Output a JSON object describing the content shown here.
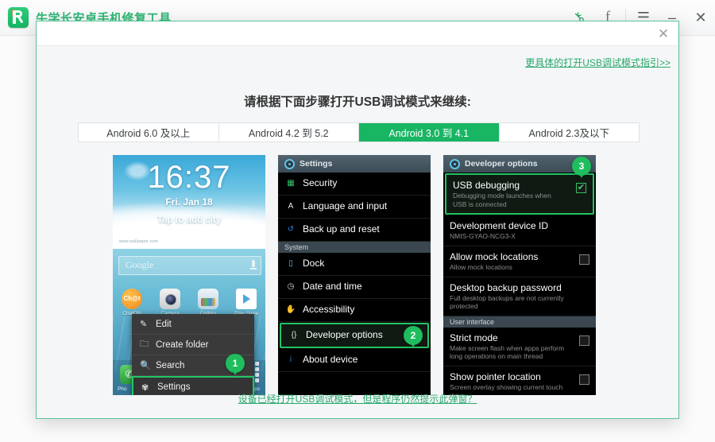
{
  "titlebar": {
    "app_title": "牛学长安卓手机修复工具",
    "icons": {
      "key": "key-icon",
      "facebook": "f",
      "menu": "☰",
      "minimize": "–",
      "close": "✕"
    }
  },
  "dialog": {
    "close_label": "✕",
    "guide_link": "更具体的打开USB调试模式指引>>",
    "headline": "请根据下面步骤打开USB调试模式来继续:",
    "bottom_link": "设备已经打开USB调试模式，但是程序仍然提示此弹窗？",
    "tabs": [
      {
        "label": "Android 6.0 及以上",
        "active": false
      },
      {
        "label": "Android 4.2 到 5.2",
        "active": false
      },
      {
        "label": "Android 3.0 到 4.1",
        "active": true
      },
      {
        "label": "Android 2.3及以下",
        "active": false
      }
    ]
  },
  "phone1": {
    "clock": "16:37",
    "date": "Fri. Jan 18",
    "city": "Tap to add city",
    "tiny": "www.wallpaper.com",
    "google": "Google",
    "apps": [
      {
        "label": "ChatON"
      },
      {
        "label": "Camera"
      },
      {
        "label": "Gallery"
      },
      {
        "label": "Play Store"
      }
    ],
    "chat_text": "Ch@t",
    "dock_phone": "Pho",
    "dock_apps": "pps",
    "menu": [
      {
        "icon": "✎",
        "label": "Edit",
        "selected": false
      },
      {
        "icon": "🗀",
        "label": "Create folder",
        "selected": false
      },
      {
        "icon": "🔍",
        "label": "Search",
        "selected": false
      },
      {
        "icon": "✾",
        "label": "Settings",
        "selected": true
      }
    ],
    "badge": "1"
  },
  "phone2": {
    "header": "Settings",
    "badge": "2",
    "rows": [
      {
        "kind": "item",
        "icon": "▦",
        "icon_color": "#2ec46a",
        "title": "Security",
        "sub": "",
        "selected": false
      },
      {
        "kind": "item",
        "icon": "A",
        "icon_color": "#e8e8e8",
        "title": "Language and input",
        "sub": "",
        "selected": false
      },
      {
        "kind": "item",
        "icon": "↺",
        "icon_color": "#2a86d6",
        "title": "Back up and reset",
        "sub": "",
        "selected": false
      },
      {
        "kind": "section",
        "title": "System"
      },
      {
        "kind": "item",
        "icon": "▯",
        "icon_color": "#6ab6e8",
        "title": "Dock",
        "sub": "",
        "selected": false
      },
      {
        "kind": "item",
        "icon": "◷",
        "icon_color": "#dcdcdc",
        "title": "Date and time",
        "sub": "",
        "selected": false
      },
      {
        "kind": "item",
        "icon": "✋",
        "icon_color": "#f0c14b",
        "title": "Accessibility",
        "sub": "",
        "selected": false
      },
      {
        "kind": "item",
        "icon": "{}",
        "icon_color": "#dcdcdc",
        "title": "Developer options",
        "sub": "",
        "selected": true
      },
      {
        "kind": "item",
        "icon": "i",
        "icon_color": "#2a86d6",
        "title": "About device",
        "sub": "",
        "selected": false
      }
    ]
  },
  "phone3": {
    "header": "Developer options",
    "badge": "3",
    "rows": [
      {
        "kind": "item",
        "title": "USB debugging",
        "sub": "Debugging mode launches when USB is connected",
        "selected": true,
        "check": "on"
      },
      {
        "kind": "item",
        "title": "Development device ID",
        "sub": "NMIS-GYAO-NCG3-X",
        "selected": false,
        "check": "none"
      },
      {
        "kind": "item",
        "title": "Allow mock locations",
        "sub": "Allow mock locations",
        "selected": false,
        "check": "off"
      },
      {
        "kind": "item",
        "title": "Desktop backup password",
        "sub": "Full desktop backups are not currently protected",
        "selected": false,
        "check": "none"
      },
      {
        "kind": "section",
        "title": "User interface"
      },
      {
        "kind": "item",
        "title": "Strict mode",
        "sub": "Make screen flash when apps perform long operations on main thread",
        "selected": false,
        "check": "off"
      },
      {
        "kind": "item",
        "title": "Show pointer location",
        "sub": "Screen overlay showing current touch data",
        "selected": false,
        "check": "off"
      }
    ],
    "check_glyph": "✔"
  },
  "colors": {
    "accent_green": "#18b563",
    "link_green": "#2aa86a",
    "badge_green": "#1fbd5e"
  }
}
